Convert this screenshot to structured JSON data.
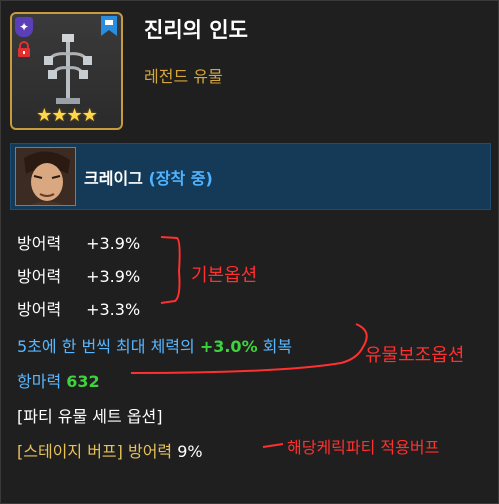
{
  "item": {
    "name": "진리의 인도",
    "grade": "레전드 유물",
    "stars": "★★★★",
    "grade_icon": "✦"
  },
  "equipped": {
    "character": "크레이그",
    "status": "(장착 중)"
  },
  "base_options": [
    {
      "label": "방어력",
      "value": "+3.9%"
    },
    {
      "label": "방어력",
      "value": "+3.9%"
    },
    {
      "label": "방어력",
      "value": "+3.3%"
    }
  ],
  "sub_option": {
    "prefix": "5초에 한 번씩 최대 체력의 ",
    "value": "+3.0%",
    "suffix": " 회복"
  },
  "magic_resist": {
    "label": "항마력",
    "value": "632"
  },
  "set_title": "[파티 유물 세트 옵션]",
  "stage_buff": {
    "label": "[스테이지 버프]",
    "stat": "방어력",
    "value": "9%"
  },
  "annotations": {
    "base": "기본옵션",
    "sub": "유물보조옵션",
    "buff": "해당케릭파티 적용버프"
  },
  "colors": {
    "annotation": "#ff3030",
    "grade": "#d6a53c",
    "equipped": "#4fb3ff",
    "positive": "#3ed33e"
  }
}
